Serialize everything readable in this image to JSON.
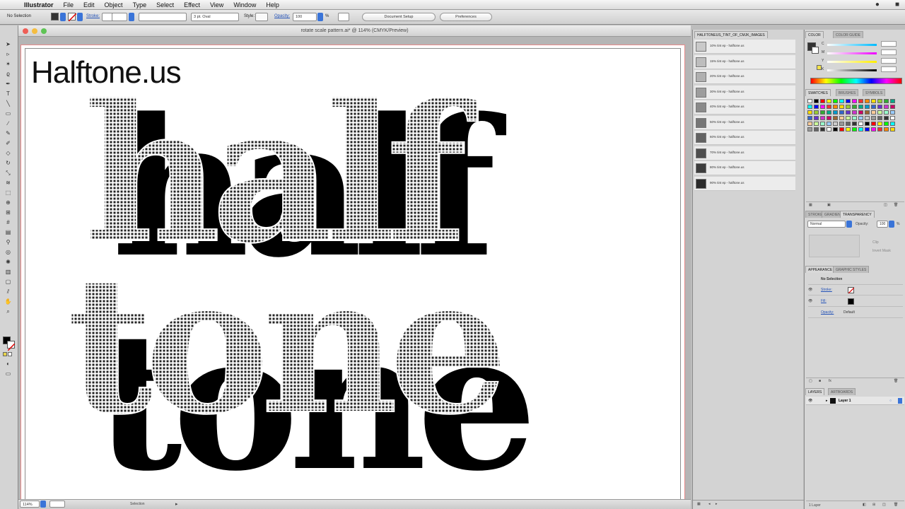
{
  "menubar": {
    "app": "Illustrator",
    "items": [
      "File",
      "Edit",
      "Object",
      "Type",
      "Select",
      "Effect",
      "View",
      "Window",
      "Help"
    ]
  },
  "controlbar": {
    "selection": "No Selection",
    "stroke_label": "Stroke:",
    "brush": "3 pt. Oval",
    "style_label": "Style:",
    "opacity_label": "Opacity:",
    "opacity": "100",
    "percent": "%",
    "doc_setup": "Document Setup",
    "preferences": "Preferences"
  },
  "document": {
    "title": "rotate scale pattern.ai* @ 114% (CMYK/Preview)",
    "headline": "Halftone.us",
    "art_line1": "half",
    "art_line2": "tone",
    "zoom": "114%",
    "status_tool": "Selection"
  },
  "tint_panel": {
    "tab": "HALFTONEUS_TINT_OF_CMJK_IMAGES",
    "rows": [
      {
        "label": "10% tint ep - halftone.us",
        "shade": "#c9c9c9"
      },
      {
        "label": "15% tint ep - halftone.us",
        "shade": "#bdbdbd"
      },
      {
        "label": "20% tint ep - halftone.us",
        "shade": "#b0b0b0"
      },
      {
        "label": "30% tint ep - halftone.us",
        "shade": "#9d9d9d"
      },
      {
        "label": "40% tint ep - halftone.us",
        "shade": "#8a8a8a"
      },
      {
        "label": "50% tint ep - halftone.us",
        "shade": "#767676"
      },
      {
        "label": "60% tint ep - halftone.us",
        "shade": "#626262"
      },
      {
        "label": "70% tint ep - halftone.us",
        "shade": "#4f4f4f"
      },
      {
        "label": "80% tint ep - halftone.us",
        "shade": "#3d3d3d"
      },
      {
        "label": "90% tint ep - halftone.us",
        "shade": "#2b2b2b"
      }
    ]
  },
  "color_panel": {
    "tabs": [
      "COLOR",
      "COLOR GUIDE"
    ],
    "channels": [
      "C",
      "M",
      "Y",
      "K"
    ]
  },
  "swatches_panel": {
    "tabs": [
      "SWATCHES",
      "BRUSHES",
      "SYMBOLS"
    ]
  },
  "transparency_panel": {
    "tabs": [
      "STROKE",
      "GRADIEN",
      "TRANSPARENCY"
    ],
    "mode": "Normal",
    "opacity_label": "Opacity:",
    "opacity": "100",
    "percent": "%",
    "clip": "Clip",
    "invert_mask": "Invert Mask"
  },
  "appearance_panel": {
    "tabs": [
      "APPEARANCE",
      "GRAPHIC STYLES"
    ],
    "selection": "No Selection",
    "stroke_label": "Stroke:",
    "fill_label": "Fill:",
    "opacity_label": "Opacity:",
    "opacity_value": "Default"
  },
  "layers_panel": {
    "tabs": [
      "LAYERS",
      "ARTBOARDS"
    ],
    "layer_name": "Layer 1",
    "footer": "1 Layer"
  }
}
